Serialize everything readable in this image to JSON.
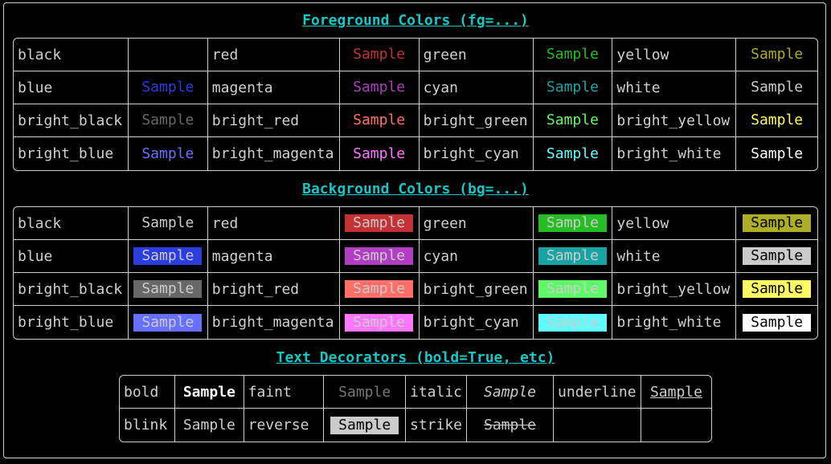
{
  "fg_title": "Foreground Colors (fg=...)",
  "bg_title": "Background Colors (bg=...)",
  "dec_title": "Text Decorators (bold=True, etc)",
  "sample": "Sample",
  "colors": {
    "black": "#000000",
    "red": "#c23133",
    "green": "#25bc24",
    "yellow": "#adad27",
    "blue": "#2c3ddf",
    "magenta": "#b13dc2",
    "cyan": "#19a4a4",
    "white": "#cbcbcb",
    "bright_black": "#686868",
    "bright_red": "#ff6e67",
    "bright_green": "#5ff967",
    "bright_yellow": "#fefb67",
    "bright_blue": "#6871ff",
    "bright_magenta": "#ff77ff",
    "bright_cyan": "#60fdff",
    "bright_white": "#ffffff"
  },
  "fg_rows": [
    [
      "black",
      "red",
      "green",
      "yellow"
    ],
    [
      "blue",
      "magenta",
      "cyan",
      "white"
    ],
    [
      "bright_black",
      "bright_red",
      "bright_green",
      "bright_yellow"
    ],
    [
      "bright_blue",
      "bright_magenta",
      "bright_cyan",
      "bright_white"
    ]
  ],
  "bg_rows": [
    [
      "black",
      "red",
      "green",
      "yellow"
    ],
    [
      "blue",
      "magenta",
      "cyan",
      "white"
    ],
    [
      "bright_black",
      "bright_red",
      "bright_green",
      "bright_yellow"
    ],
    [
      "bright_blue",
      "bright_magenta",
      "bright_cyan",
      "bright_white"
    ]
  ],
  "dec_rows": [
    [
      "bold",
      "faint",
      "italic",
      "underline"
    ],
    [
      "blink",
      "reverse",
      "strike",
      ""
    ]
  ]
}
